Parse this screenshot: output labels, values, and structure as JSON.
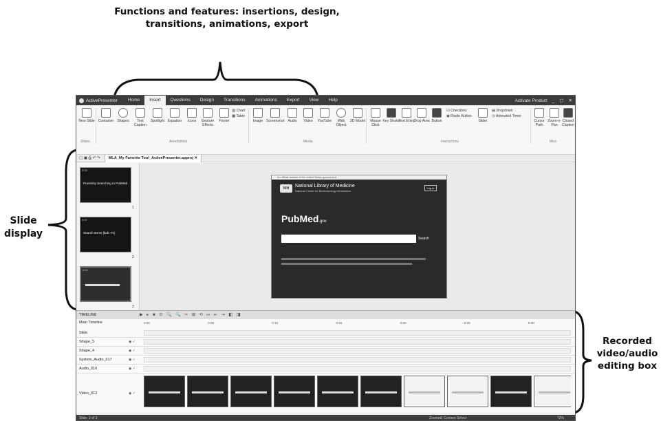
{
  "annotations": {
    "top": "Functions and features: insertions, design, transitions, animations, export",
    "left": "Slide display",
    "right": "Recorded video/audio editing box"
  },
  "app": {
    "name": "ActivePresenter",
    "tabs": [
      "Home",
      "Insert",
      "Questions",
      "Design",
      "Transitions",
      "Animations",
      "Export",
      "View",
      "Help"
    ],
    "active_tab": "Insert",
    "activate_label": "Activate Product"
  },
  "ribbon": {
    "buttons": [
      {
        "id": "new-slide",
        "label": "New Slide"
      },
      {
        "id": "container",
        "label": "Container"
      },
      {
        "id": "shapes",
        "label": "Shapes"
      },
      {
        "id": "text-caption",
        "label": "Text Caption"
      },
      {
        "id": "spotlight",
        "label": "Spotlight"
      },
      {
        "id": "equation",
        "label": "Equation"
      },
      {
        "id": "icons",
        "label": "Icons"
      },
      {
        "id": "gesture-effects",
        "label": "Gesture Effects"
      },
      {
        "id": "footer",
        "label": "Footer"
      },
      {
        "id": "image",
        "label": "Image"
      },
      {
        "id": "screenshot",
        "label": "Screenshot"
      },
      {
        "id": "audio",
        "label": "Audio"
      },
      {
        "id": "video",
        "label": "Video"
      },
      {
        "id": "youtube",
        "label": "YouTube"
      },
      {
        "id": "web-object",
        "label": "Web Object"
      },
      {
        "id": "3d-model",
        "label": "3D Model"
      },
      {
        "id": "mouse-click",
        "label": "Mouse Click"
      },
      {
        "id": "key-stroke",
        "label": "Key Stroke"
      },
      {
        "id": "text-entry",
        "label": "Text Entry"
      },
      {
        "id": "drop-area",
        "label": "Drop Area"
      },
      {
        "id": "button",
        "label": "Button"
      },
      {
        "id": "slider",
        "label": "Slider"
      },
      {
        "id": "cursor-path",
        "label": "Cursor Path"
      },
      {
        "id": "zoom-n-pan",
        "label": "Zoom-n-Pan"
      },
      {
        "id": "closed-caption",
        "label": "Closed Caption"
      }
    ],
    "small": {
      "chart": "Chart",
      "table": "Table",
      "checkbox": "Checkbox",
      "radio_button": "Radio Button",
      "dropdown": "Dropdown",
      "animated_timer": "Animated Timer"
    },
    "groups": {
      "slides": "Slides",
      "annotations": "Annotations",
      "media": "Media",
      "interactions": "Interactions",
      "misc": "Misc"
    }
  },
  "document": {
    "tab_title": "MLA_My Favorite Tool_ActivePresenter.approj"
  },
  "slides": [
    {
      "time": "0:03",
      "title": "Proximity Searching in PubMed",
      "number": "1"
    },
    {
      "time": "0:07",
      "title": "Search terms [tiab:~N]",
      "number": "2"
    },
    {
      "time": "0:12",
      "title": "",
      "number": "3"
    }
  ],
  "canvas": {
    "banner": "An official website of the United States government",
    "org": "National Library of Medicine",
    "org_sub": "National Center for Biotechnology Information",
    "login": "Log in",
    "logo": "NIH",
    "pubmed": "PubMed",
    "pubmed_suffix": ".gov",
    "search_button": "Search"
  },
  "timeline": {
    "header": "TIMELINE",
    "main_timeline": "Main Timeline",
    "rows": [
      "Slide",
      "Shape_5",
      "Shape_4",
      "System_Audio_017",
      "Audio_016",
      "Video_013"
    ],
    "ruler": [
      "0:00",
      "0:05",
      "0:10",
      "0:15",
      "0:20",
      "0:25",
      "0:30"
    ]
  },
  "status": {
    "slide_info": "Slide: 3 of 3",
    "info": "Zoomed: Content Select",
    "zoom": "72%"
  }
}
